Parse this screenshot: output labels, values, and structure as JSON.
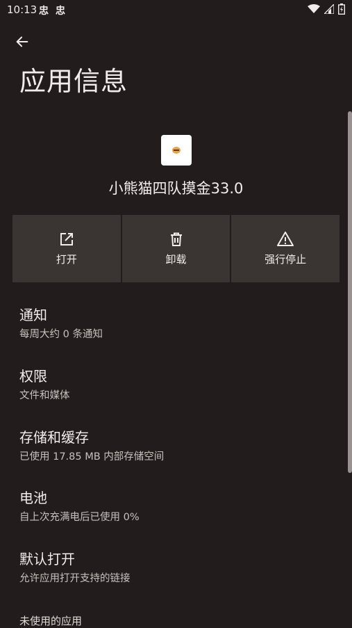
{
  "status": {
    "time": "10:13",
    "notifications": [
      "忠",
      "忠"
    ]
  },
  "header": {
    "title": "应用信息"
  },
  "app": {
    "name": "小熊猫四队摸金33.0"
  },
  "actions": [
    {
      "label": "打开",
      "icon": "open-external-icon"
    },
    {
      "label": "卸载",
      "icon": "trash-icon"
    },
    {
      "label": "强行停止",
      "icon": "warning-icon"
    }
  ],
  "items": [
    {
      "title": "通知",
      "subtitle": "每周大约 0 条通知"
    },
    {
      "title": "权限",
      "subtitle": "文件和媒体"
    },
    {
      "title": "存储和缓存",
      "subtitle": "已使用 17.85 MB 内部存储空间"
    },
    {
      "title": "电池",
      "subtitle": "自上次充满电后已使用 0%"
    },
    {
      "title": "默认打开",
      "subtitle": "允许应用打开支持的链接"
    },
    {
      "title": "未使用的应用"
    }
  ],
  "colors": {
    "background": "#221d1c",
    "button_bg": "#3a3533",
    "text": "#ede6e3"
  }
}
